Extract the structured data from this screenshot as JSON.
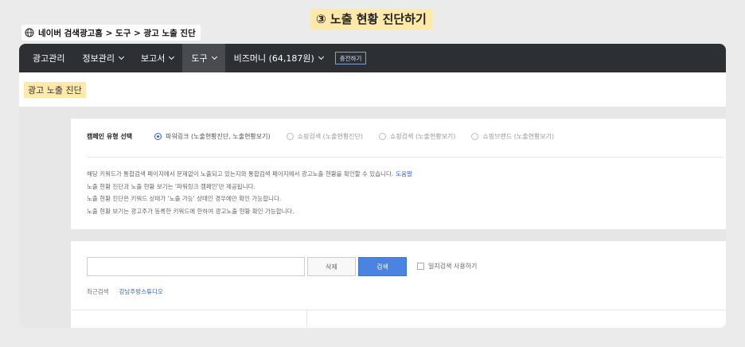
{
  "step_title": "③ 노출 현황 진단하기",
  "breadcrumb": "네이버 검색광고홈 > 도구 > 광고 노출 진단",
  "nav": {
    "items": [
      {
        "label": "광고관리",
        "has_menu": false
      },
      {
        "label": "정보관리",
        "has_menu": true
      },
      {
        "label": "보고서",
        "has_menu": true
      },
      {
        "label": "도구",
        "has_menu": true
      },
      {
        "label": "비즈머니 (64,187원)",
        "has_menu": true
      }
    ],
    "active_index": 3,
    "charge_label": "충전하기"
  },
  "page_title": "광고 노출 진단",
  "campaign": {
    "label": "캠페인 유형 선택",
    "options": [
      {
        "label": "파워링크 (노출현황진단, 노출현황보기)",
        "selected": true
      },
      {
        "label": "쇼핑검색 (노출현황진단)",
        "selected": false
      },
      {
        "label": "쇼핑검색 (노출현황보기)",
        "selected": false
      },
      {
        "label": "쇼핑브랜드 (노출현황보기)",
        "selected": false
      }
    ]
  },
  "info": {
    "line1": "해당 키워드가 통합검색 페이지에서 문제없이 노출되고 있는지와 통합검색 페이지에서 광고노출 현황을 확인할 수 있습니다.",
    "help_link": "도움말",
    "line2": "노출 현황 진단과 노출 현황 보기는 '파워링크 캠페인'만 제공됩니다.",
    "line3": "노출 현황 진단은 키워드 상태가 '노출 가능' 상태인 경우에만 확인 가능합니다.",
    "line4": "노출 현황 보기는 광고주가 등록한 키워드에 한하여 광고노출 현황 확인 가능합니다."
  },
  "search": {
    "value": "",
    "placeholder": "",
    "delete_label": "삭제",
    "search_label": "검색",
    "exact_label": "일치검색 사용하기"
  },
  "recent": {
    "label": "최근검색",
    "item": "강남주방스튜디오"
  },
  "colors": {
    "highlight": "#fde9a9",
    "navbar": "#2e2f32",
    "accent": "#2c64d8",
    "search_button": "#4a84e0"
  }
}
